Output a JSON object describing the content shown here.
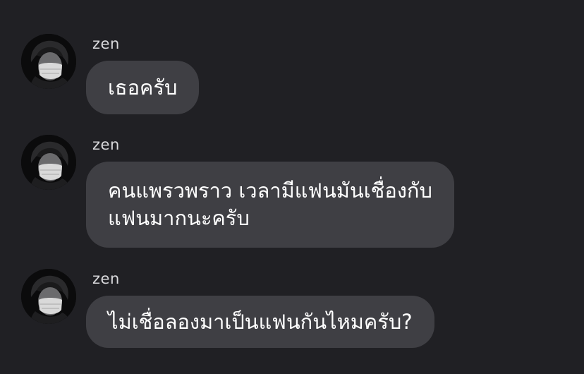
{
  "messages": [
    {
      "sender": "zen",
      "lines": [
        "เธอครับ"
      ]
    },
    {
      "sender": "zen",
      "lines": [
        "คนแพรวพราว เวลามีแฟนมันเชื่องกับ",
        "แฟนมากนะครับ"
      ]
    },
    {
      "sender": "zen",
      "lines": [
        "ไม่เชื่อลองมาเป็นแฟนกันไหมครับ?"
      ]
    }
  ],
  "colors": {
    "background": "#202024",
    "bubble": "#3f3f44",
    "sender_text": "#d9d9dc",
    "message_text": "#ffffff"
  },
  "icons": {
    "avatar": "profile-photo-masked-person"
  }
}
